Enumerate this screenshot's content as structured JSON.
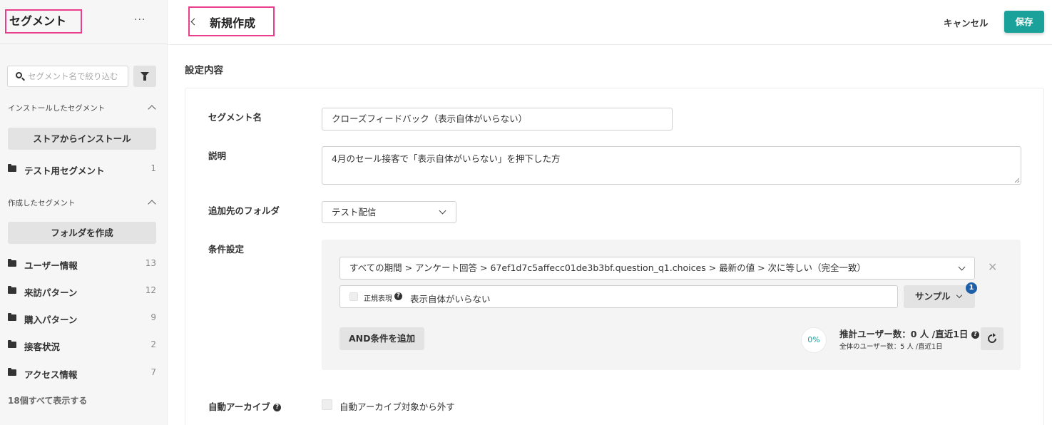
{
  "sidebar": {
    "title": "セグメント",
    "more": "···",
    "search_placeholder": "セグメント名で絞り込む",
    "installed_section": "インストールしたセグメント",
    "install_button": "ストアからインストール",
    "installed_items": [
      {
        "label": "テスト用セグメント",
        "count": "1"
      }
    ],
    "created_section": "作成したセグメント",
    "create_folder_button": "フォルダを作成",
    "created_items": [
      {
        "label": "ユーザー情報",
        "count": "13"
      },
      {
        "label": "来訪パターン",
        "count": "12"
      },
      {
        "label": "購入パターン",
        "count": "9"
      },
      {
        "label": "接客状況",
        "count": "2"
      },
      {
        "label": "アクセス情報",
        "count": "7"
      }
    ],
    "show_all": "18個すべて表示する"
  },
  "header": {
    "title": "新規作成",
    "cancel_label": "キャンセル",
    "save_label": "保存"
  },
  "form": {
    "section_title": "設定内容",
    "name_label": "セグメント名",
    "name_value": "クローズフィードバック（表示自体がいらない）",
    "desc_label": "説明",
    "desc_value": "4月のセール接客で「表示自体がいらない」を押下した方",
    "folder_label": "追加先のフォルダ",
    "folder_value": "テスト配信",
    "condition_label": "条件設定",
    "condition_value": "すべての期間 > アンケート回答 > 67ef1d7c5affecc01de3b3bf.question_q1.choices > 最新の値 > 次に等しい（完全一致）",
    "regex_label": "正規表現",
    "match_value": "表示自体がいらない",
    "sample_label": "サンプル",
    "sample_badge": "1",
    "and_button": "AND条件を追加",
    "percent": "0%",
    "estimate_main": "推計ユーザー数：0 人 /直近1日",
    "estimate_sub": "全体のユーザー数：5 人 /直近1日",
    "auto_archive_label": "自動アーカイブ",
    "auto_archive_option": "自動アーカイブ対象から外す"
  },
  "colors": {
    "accent": "#1aa199",
    "highlight": "#e83e8c",
    "badge": "#1d5fa8"
  }
}
